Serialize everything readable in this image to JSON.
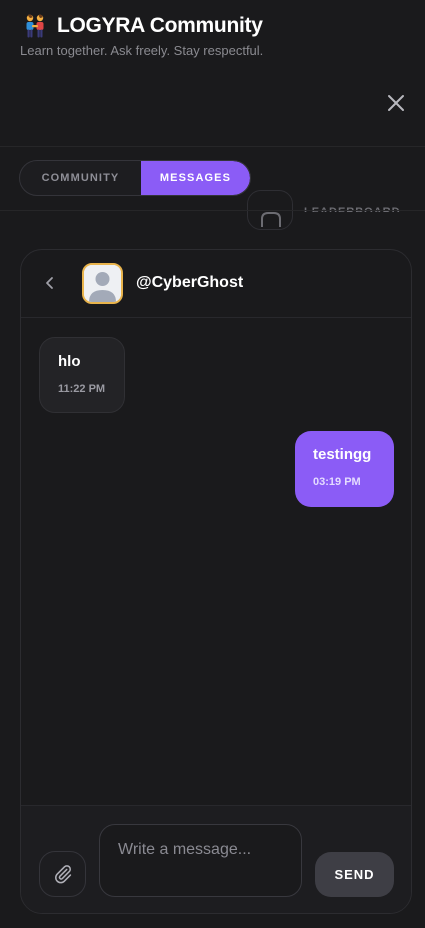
{
  "header": {
    "title": "LOGYRA Community",
    "subtitle": "Learn together. Ask freely. Stay respectful.",
    "logo_icon": "people-holding-hands-icon",
    "close_icon": "close-icon"
  },
  "tabs": [
    {
      "label": "COMMUNITY",
      "active": false
    },
    {
      "label": "MESSAGES",
      "active": true
    }
  ],
  "background_row": {
    "label": "LEADERBOARD",
    "icon": "user-icon"
  },
  "chat": {
    "back_icon": "chevron-left-icon",
    "avatar_icon": "default-avatar-icon",
    "username": "@CyberGhost",
    "messages": [
      {
        "direction": "incoming",
        "text": "hlo",
        "time": "11:22 PM"
      },
      {
        "direction": "outgoing",
        "text": "testingg",
        "time": "03:19 PM"
      }
    ]
  },
  "composer": {
    "attach_icon": "paperclip-icon",
    "placeholder": "Write a message...",
    "value": "",
    "send_label": "SEND"
  },
  "colors": {
    "background": "#1a1a1c",
    "accent": "#8b5cf6",
    "avatar_border": "#e9b44c",
    "send_button": "#3e3e45"
  }
}
